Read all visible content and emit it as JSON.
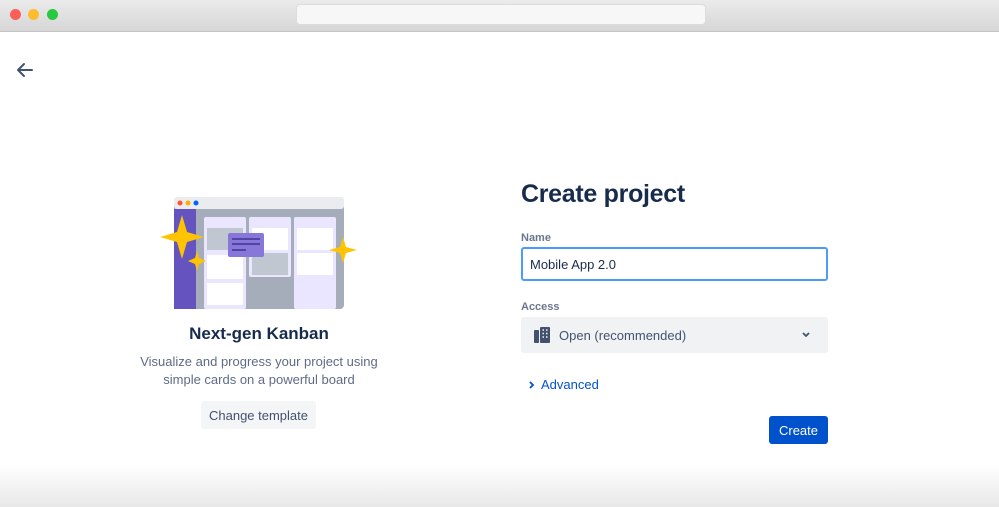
{
  "window": {
    "address": ""
  },
  "template": {
    "name": "Next-gen Kanban",
    "description_line1": "Visualize and progress your project using",
    "description_line2": "simple cards on a powerful board",
    "change_label": "Change template"
  },
  "form": {
    "title": "Create project",
    "name_label": "Name",
    "name_value": "Mobile App 2.0",
    "access_label": "Access",
    "access_value": "Open (recommended)",
    "advanced_label": "Advanced",
    "create_label": "Create"
  },
  "colors": {
    "primary": "#0052cc",
    "focus": "#4c9aff",
    "illustration": "#6554c0",
    "sparkle": "#ffc400"
  }
}
